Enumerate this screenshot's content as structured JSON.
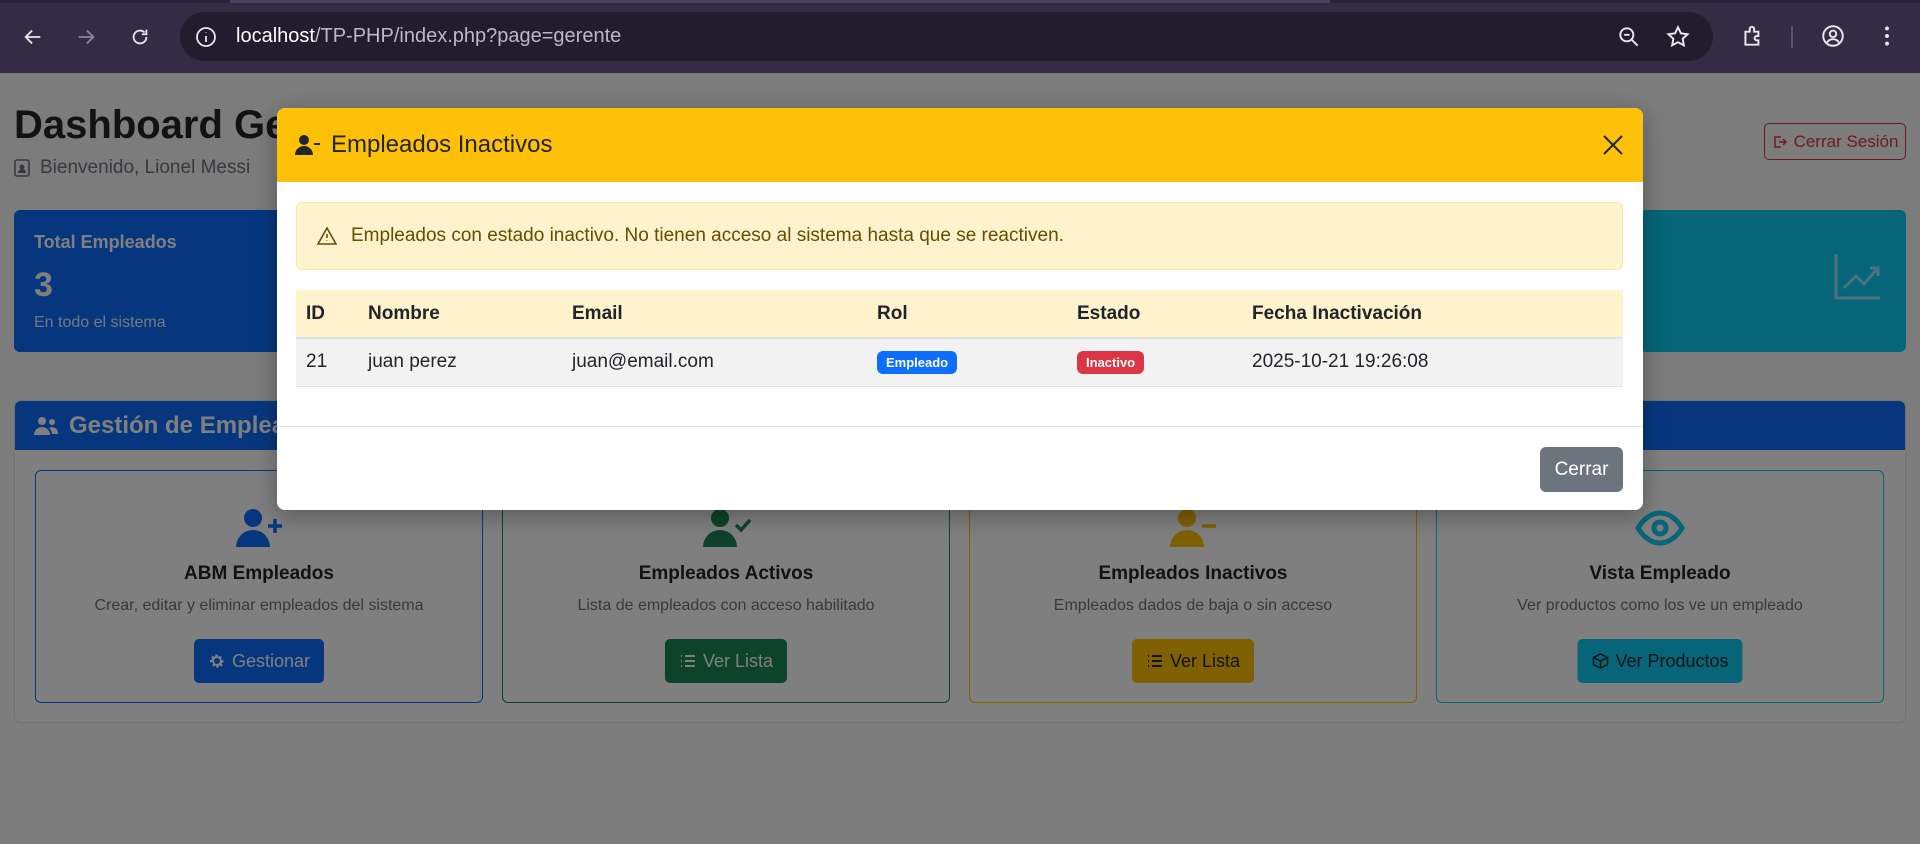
{
  "browser": {
    "url_host": "localhost",
    "url_path": "/TP-PHP/index.php?page=gerente"
  },
  "page": {
    "title": "Dashboard Gerente",
    "welcome": "Bienvenido, Lionel Messi",
    "logout_label": "Cerrar Sesión",
    "stats": {
      "total_label": "Total Empleados",
      "total_value": "3",
      "total_sub": "En todo el sistema"
    },
    "management": {
      "title": "Gestión de Empleados",
      "cards": [
        {
          "title": "ABM Empleados",
          "desc": "Crear, editar y eliminar empleados del sistema",
          "button": "Gestionar",
          "color": "#0d6efd"
        },
        {
          "title": "Empleados Activos",
          "desc": "Lista de empleados con acceso habilitado",
          "button": "Ver Lista",
          "color": "#198754"
        },
        {
          "title": "Empleados Inactivos",
          "desc": "Empleados dados de baja o sin acceso",
          "button": "Ver Lista",
          "color": "#ffc107"
        },
        {
          "title": "Vista Empleado",
          "desc": "Ver productos como los ve un empleado",
          "button": "Ver Productos",
          "color": "#0dcaf0"
        }
      ]
    }
  },
  "modal": {
    "title": "Empleados Inactivos",
    "alert": "Empleados con estado inactivo. No tienen acceso al sistema hasta que se reactiven.",
    "columns": [
      "ID",
      "Nombre",
      "Email",
      "Rol",
      "Estado",
      "Fecha Inactivación"
    ],
    "rows": [
      {
        "id": "21",
        "nombre": "juan perez",
        "email": "juan@email.com",
        "rol": "Empleado",
        "estado": "Inactivo",
        "fecha": "2025-10-21 19:26:08"
      }
    ],
    "close_label": "Cerrar",
    "header_color": "#ffc107"
  }
}
